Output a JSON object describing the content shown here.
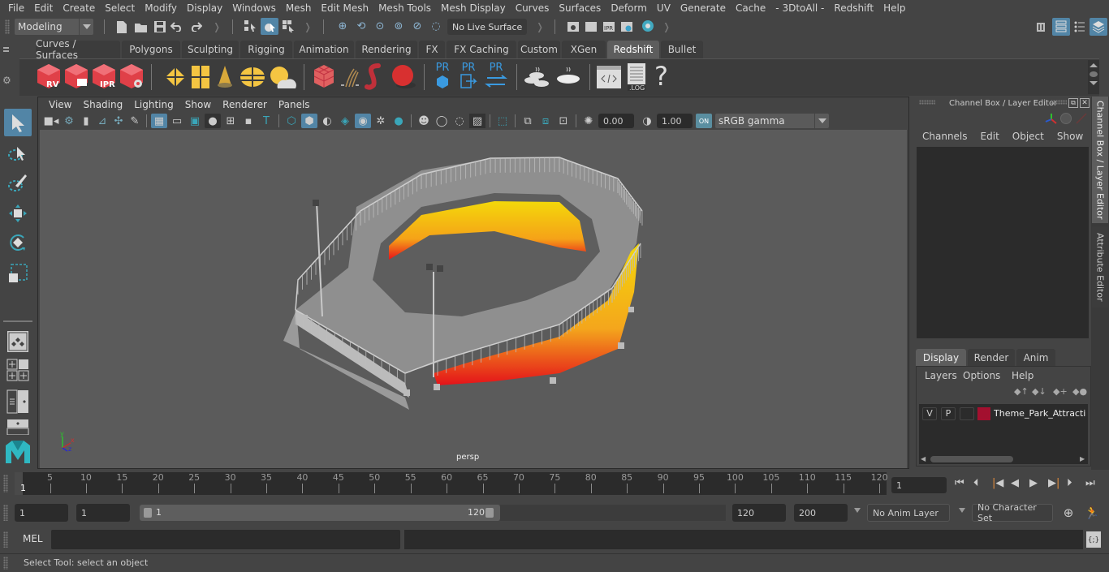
{
  "menubar": {
    "items": [
      "File",
      "Edit",
      "Create",
      "Select",
      "Modify",
      "Display",
      "Windows",
      "Mesh",
      "Edit Mesh",
      "Mesh Tools",
      "Mesh Display",
      "Curves",
      "Surfaces",
      "Deform",
      "UV",
      "Generate",
      "Cache",
      "- 3DtoAll -",
      "Redshift",
      "Help"
    ]
  },
  "statusline": {
    "workspace": "Modeling",
    "live_surface": "No Live Surface"
  },
  "shelf": {
    "tabs": [
      "Curves / Surfaces",
      "Polygons",
      "Sculpting",
      "Rigging",
      "Animation",
      "Rendering",
      "FX",
      "FX Caching",
      "Custom",
      "XGen",
      "Redshift",
      "Bullet"
    ],
    "active_tab": "Redshift",
    "icon_labels": {
      "rv": "RV",
      "ipr": "IPR",
      "pr": "PR",
      "log": ".LOG",
      "help": "?"
    }
  },
  "viewport": {
    "menu": [
      "View",
      "Shading",
      "Lighting",
      "Show",
      "Renderer",
      "Panels"
    ],
    "exposure": "0.00",
    "gamma": "1.00",
    "color_space": "sRGB gamma",
    "camera_label": "persp",
    "axis": {
      "x": "x",
      "y": "y",
      "z": "z"
    }
  },
  "channel_box": {
    "title": "Channel Box / Layer Editor",
    "menu": [
      "Channels",
      "Edit",
      "Object",
      "Show"
    ],
    "layer_tabs": [
      "Display",
      "Render",
      "Anim"
    ],
    "active_layer_tab": "Display",
    "layer_menu": [
      "Layers",
      "Options",
      "Help"
    ],
    "layers": [
      {
        "visible": "V",
        "playback": "P",
        "color": "#a3102f",
        "name": "Theme_Park_Attraction"
      }
    ]
  },
  "side_tabs": [
    "Channel Box / Layer Editor",
    "Attribute Editor"
  ],
  "timeline": {
    "start_label": "1",
    "ticks": [
      5,
      10,
      15,
      20,
      25,
      30,
      35,
      40,
      45,
      50,
      55,
      60,
      65,
      70,
      75,
      80,
      85,
      90,
      95,
      100,
      105,
      110,
      115,
      120
    ],
    "current_frame": "1"
  },
  "range": {
    "start_time": "1",
    "playback_start": "1",
    "slider_start": "1",
    "slider_end": "120",
    "playback_end": "120",
    "end_time": "200",
    "anim_layer": "No Anim Layer",
    "character_set": "No Character Set"
  },
  "command_line": {
    "label": "MEL",
    "value": "",
    "result": ""
  },
  "help_line": "Select Tool: select an object"
}
